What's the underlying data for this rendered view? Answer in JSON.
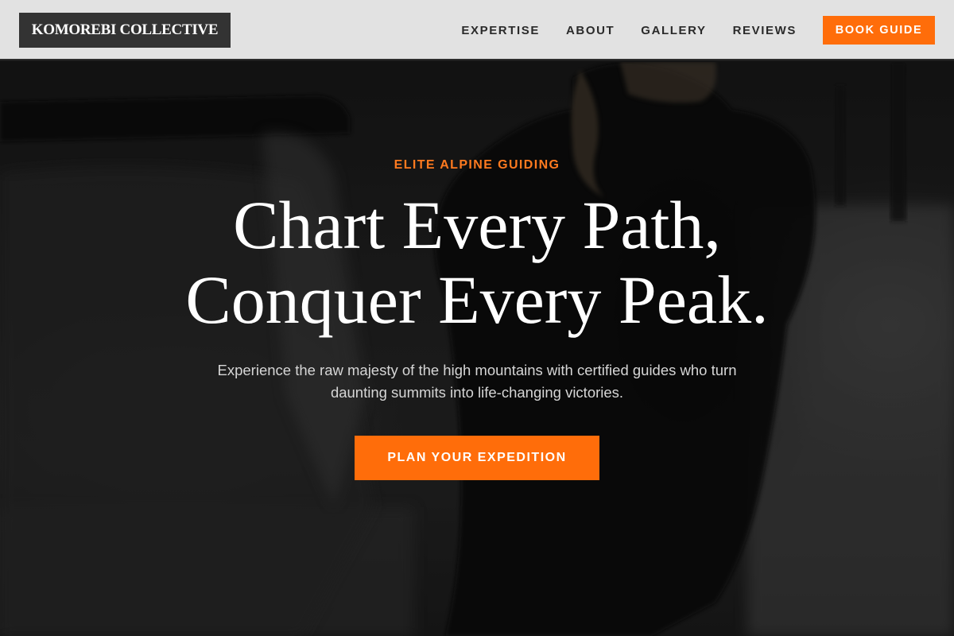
{
  "header": {
    "logo_text": "KOMOREBI COLLECTIVE",
    "nav_items": [
      {
        "label": "EXPERTISE"
      },
      {
        "label": "ABOUT"
      },
      {
        "label": "GALLERY"
      },
      {
        "label": "REVIEWS"
      }
    ],
    "cta_label": "BOOK GUIDE"
  },
  "hero": {
    "eyebrow": "ELITE ALPINE GUIDING",
    "headline_line1": "Chart Every Path,",
    "headline_line2": "Conquer Every Peak.",
    "subtext": "Experience the raw majesty of the high mountains with certified guides who turn daunting summits into life-changing victories.",
    "cta_label": "PLAN YOUR EXPEDITION"
  },
  "colors": {
    "accent": "#ff6d0a",
    "nav_background": "#e2e2e2",
    "logo_background": "#333333",
    "eyebrow": "#ff7a1f"
  }
}
